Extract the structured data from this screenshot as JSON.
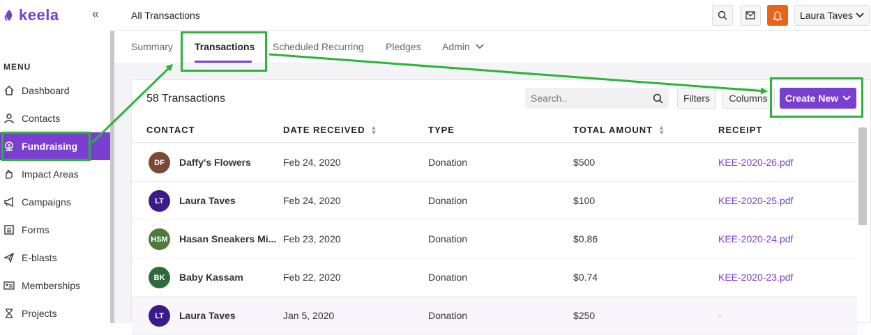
{
  "app": {
    "name": "keela"
  },
  "sidebar": {
    "menu_label": "MENU",
    "items": [
      {
        "label": "Dashboard",
        "icon": "home-icon"
      },
      {
        "label": "Contacts",
        "icon": "user-icon"
      },
      {
        "label": "Fundraising",
        "icon": "fundraising-icon",
        "active": true
      },
      {
        "label": "Impact Areas",
        "icon": "hand-icon"
      },
      {
        "label": "Campaigns",
        "icon": "megaphone-icon"
      },
      {
        "label": "Forms",
        "icon": "form-icon"
      },
      {
        "label": "E-blasts",
        "icon": "send-icon"
      },
      {
        "label": "Memberships",
        "icon": "id-card-icon"
      },
      {
        "label": "Projects",
        "icon": "hourglass-icon"
      }
    ]
  },
  "header": {
    "title": "All Transactions",
    "user": "Laura Taves"
  },
  "tabs": [
    {
      "label": "Summary"
    },
    {
      "label": "Transactions",
      "active": true
    },
    {
      "label": "Scheduled Recurring"
    },
    {
      "label": "Pledges"
    },
    {
      "label": "Admin"
    }
  ],
  "toolbar": {
    "count_label": "58 Transactions",
    "search_placeholder": "Search..",
    "filters_label": "Filters",
    "columns_label": "Columns",
    "create_label": "Create New"
  },
  "table": {
    "columns": [
      "CONTACT",
      "DATE RECEIVED",
      "TYPE",
      "TOTAL AMOUNT",
      "RECEIPT"
    ],
    "rows": [
      {
        "initials": "DF",
        "avatar_color": "#7b4a36",
        "contact": "Daffy's Flowers",
        "date": "Feb 24, 2020",
        "type": "Donation",
        "amount": "$500",
        "receipt": "KEE-2020-26.pdf"
      },
      {
        "initials": "LT",
        "avatar_color": "#3d1a8a",
        "contact": "Laura Taves",
        "date": "Feb 24, 2020",
        "type": "Donation",
        "amount": "$100",
        "receipt": "KEE-2020-25.pdf"
      },
      {
        "initials": "HSM",
        "avatar_color": "#4e7a3a",
        "contact": "Hasan Sneakers Mi...",
        "date": "Feb 23, 2020",
        "type": "Donation",
        "amount": "$0.86",
        "receipt": "KEE-2020-24.pdf"
      },
      {
        "initials": "BK",
        "avatar_color": "#2e6b3a",
        "contact": "Baby Kassam",
        "date": "Feb 22, 2020",
        "type": "Donation",
        "amount": "$0.74",
        "receipt": "KEE-2020-23.pdf"
      },
      {
        "initials": "LT",
        "avatar_color": "#3d1a8a",
        "contact": "Laura Taves",
        "date": "Jan 5, 2020",
        "type": "Donation",
        "amount": "$250",
        "receipt": "-"
      }
    ]
  },
  "colors": {
    "accent": "#7a3fd0",
    "annotation": "#2bb33a",
    "bell": "#e8641b"
  }
}
